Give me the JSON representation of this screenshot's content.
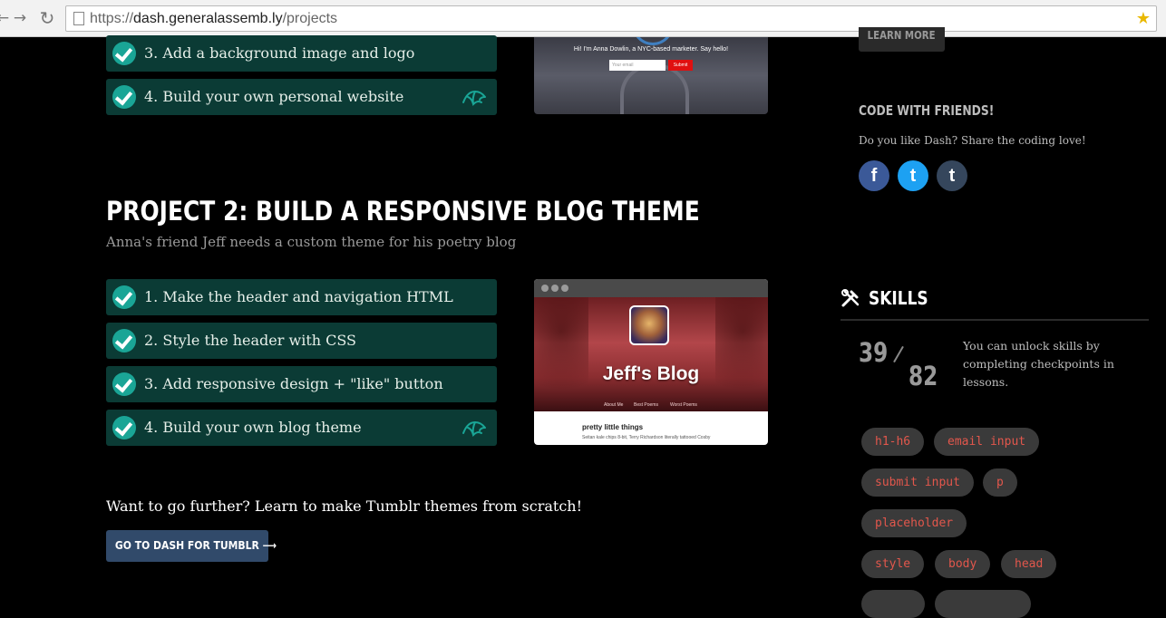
{
  "browser": {
    "url_scheme": "https://",
    "url_domain": "dash.generalassemb.ly",
    "url_path": "/projects"
  },
  "project1": {
    "tasks": [
      {
        "label": "3. Add a background image and logo"
      },
      {
        "label": "4. Build your own personal website"
      }
    ],
    "preview": {
      "caption": "Hi! I'm Anna Dowlin, a NYC-based marketer. Say hello!",
      "email_placeholder": "Your email",
      "submit_label": "Submit"
    }
  },
  "project2": {
    "title": "PROJECT 2: BUILD A RESPONSIVE BLOG THEME",
    "subtitle": "Anna's friend Jeff needs a custom theme for his poetry blog",
    "tasks": [
      {
        "label": "1. Make the header and navigation HTML"
      },
      {
        "label": "2. Style the header with CSS"
      },
      {
        "label": "3. Add responsive design + \"like\" button"
      },
      {
        "label": "4. Build your own blog theme"
      }
    ],
    "preview": {
      "blog_title": "Jeff's Blog",
      "nav": [
        "About Me",
        "Best Poems",
        "Worst Poems"
      ],
      "post_title": "pretty little things",
      "post_body": "Seitan kale chips 8-bit, Terry Richardson literally tattooed Cosby"
    }
  },
  "further": {
    "text": "Want to go further? Learn to make Tumblr themes from scratch!",
    "button_label": "GO TO DASH FOR TUMBLR ⟶"
  },
  "sidebar": {
    "learn_more_label": "LEARN MORE",
    "code_with_friends_title": "CODE WITH FRIENDS!",
    "share_text": "Do you like Dash? Share the coding love!",
    "social": [
      {
        "name": "facebook",
        "glyph": "f"
      },
      {
        "name": "twitter",
        "glyph": "t"
      },
      {
        "name": "tumblr",
        "glyph": "t"
      }
    ],
    "skills": {
      "title": "SKILLS",
      "unlocked": "39",
      "total": "82",
      "description": "You can unlock skills by completing checkpoints in lessons.",
      "tags": [
        "h1-h6",
        "email input",
        "submit input",
        "p",
        "placeholder",
        "style",
        "body",
        "head"
      ]
    }
  },
  "colors": {
    "task_bg": "#0b3b35",
    "check": "#1aa596",
    "tag_text": "#e2574c",
    "button_bg": "#314a6a"
  }
}
